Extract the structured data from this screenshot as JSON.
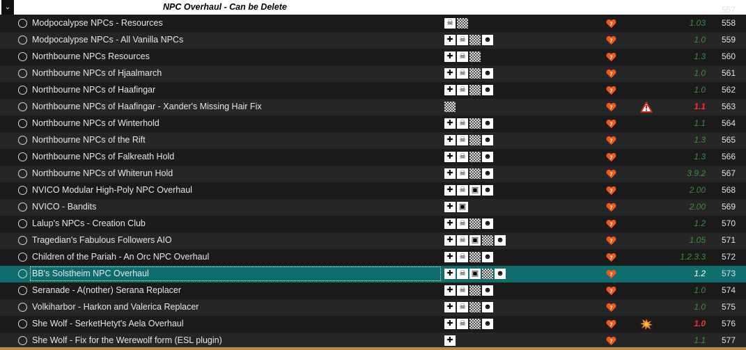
{
  "separator": {
    "toggle": "⌄",
    "title": "NPC Overhaul - Can be Delete",
    "priority": "557"
  },
  "colors": {
    "version_ok": "#3a8f3a",
    "version_warn": "#ff2a2a",
    "selected_row": "#0f6d6d"
  },
  "rows": [
    {
      "name": "Modpocalypse NPCs - Resources",
      "flags": [
        "skull-horns",
        "checker"
      ],
      "version": "1.03",
      "ver_state": "ok",
      "conflict": "",
      "priority": "558"
    },
    {
      "name": "Modpocalypse NPCs - All Vanilla NPCs",
      "flags": [
        "puzzle",
        "skull-horns",
        "checker",
        "skull-bubble"
      ],
      "version": "1.0",
      "ver_state": "ok",
      "conflict": "",
      "priority": "559"
    },
    {
      "name": "Northbourne NPCs Resources",
      "flags": [
        "puzzle",
        "skull-horns",
        "checker"
      ],
      "version": "1.3",
      "ver_state": "ok",
      "conflict": "",
      "priority": "560"
    },
    {
      "name": "Northbourne NPCs of Hjaalmarch",
      "flags": [
        "puzzle",
        "skull-horns",
        "checker",
        "skull-bubble"
      ],
      "version": "1.0",
      "ver_state": "ok",
      "conflict": "",
      "priority": "561"
    },
    {
      "name": "Northbourne NPCs of Haafingar",
      "flags": [
        "puzzle",
        "skull-horns",
        "checker",
        "skull-bubble"
      ],
      "version": "1.0",
      "ver_state": "ok",
      "conflict": "",
      "priority": "562"
    },
    {
      "name": "Northbourne NPCs of Haafingar - Xander's Missing Hair Fix",
      "flags": [
        "checker"
      ],
      "version": "1.1",
      "ver_state": "warn",
      "conflict": "warning",
      "priority": "563"
    },
    {
      "name": "Northbourne NPCs of Winterhold",
      "flags": [
        "puzzle",
        "skull-horns",
        "checker",
        "skull-bubble"
      ],
      "version": "1.1",
      "ver_state": "ok",
      "conflict": "",
      "priority": "564"
    },
    {
      "name": "Northbourne NPCs of the Rift",
      "flags": [
        "puzzle",
        "skull-horns",
        "checker",
        "skull-bubble"
      ],
      "version": "1.3",
      "ver_state": "ok",
      "conflict": "",
      "priority": "565"
    },
    {
      "name": "Northbourne NPCs of Falkreath Hold",
      "flags": [
        "puzzle",
        "skull-horns",
        "checker",
        "skull-bubble"
      ],
      "version": "1.3",
      "ver_state": "ok",
      "conflict": "",
      "priority": "566"
    },
    {
      "name": "Northbourne NPCs of Whiterun Hold",
      "flags": [
        "puzzle",
        "skull-horns",
        "checker",
        "skull-bubble"
      ],
      "version": "3.9.2",
      "ver_state": "ok",
      "conflict": "",
      "priority": "567"
    },
    {
      "name": "NVICO Modular High-Poly NPC Overhaul",
      "flags": [
        "puzzle",
        "skull-horns",
        "box",
        "skull-bubble"
      ],
      "version": "2.00",
      "ver_state": "ok",
      "conflict": "",
      "priority": "568"
    },
    {
      "name": "NVICO - Bandits",
      "flags": [
        "puzzle",
        "box"
      ],
      "version": "2.00",
      "ver_state": "ok",
      "conflict": "",
      "priority": "569"
    },
    {
      "name": "Lalup's NPCs - Creation Club",
      "flags": [
        "puzzle",
        "skull-horns",
        "checker",
        "skull-bubble"
      ],
      "version": "1.2",
      "ver_state": "ok",
      "conflict": "",
      "priority": "570"
    },
    {
      "name": "Tragedian's Fabulous Followers AIO",
      "flags": [
        "puzzle",
        "skull-horns",
        "box",
        "checker",
        "skull-bubble"
      ],
      "version": "1.05",
      "ver_state": "ok",
      "conflict": "",
      "priority": "571"
    },
    {
      "name": "Children of the Pariah - An Orc NPC Overhaul",
      "flags": [
        "puzzle",
        "skull-horns",
        "checker",
        "skull-bubble"
      ],
      "version": "1.2.3.3",
      "ver_state": "ok",
      "conflict": "",
      "priority": "572"
    },
    {
      "name": "BB's Solstheim NPC Overhaul",
      "flags": [
        "puzzle",
        "skull-horns",
        "box",
        "checker",
        "skull-bubble"
      ],
      "version": "1.2",
      "ver_state": "selected",
      "conflict": "",
      "priority": "573"
    },
    {
      "name": "Seranade - A(nother) Serana Replacer",
      "flags": [
        "puzzle",
        "skull-horns",
        "checker",
        "skull-bubble"
      ],
      "version": "1.0",
      "ver_state": "ok",
      "conflict": "",
      "priority": "574"
    },
    {
      "name": "Volkiharbor - Harkon and Valerica Replacer",
      "flags": [
        "puzzle",
        "skull-horns",
        "checker",
        "skull-bubble"
      ],
      "version": "1.0",
      "ver_state": "ok",
      "conflict": "",
      "priority": "575"
    },
    {
      "name": "She Wolf - SerketHetyt's Aela Overhaul",
      "flags": [
        "puzzle",
        "skull-horns",
        "checker",
        "skull-bubble"
      ],
      "version": "1.0",
      "ver_state": "warn",
      "conflict": "burst",
      "priority": "576"
    },
    {
      "name": "She Wolf - Fix for the Werewolf form (ESL plugin)",
      "flags": [
        "puzzle"
      ],
      "version": "1.1",
      "ver_state": "ok",
      "conflict": "",
      "priority": "577"
    }
  ]
}
